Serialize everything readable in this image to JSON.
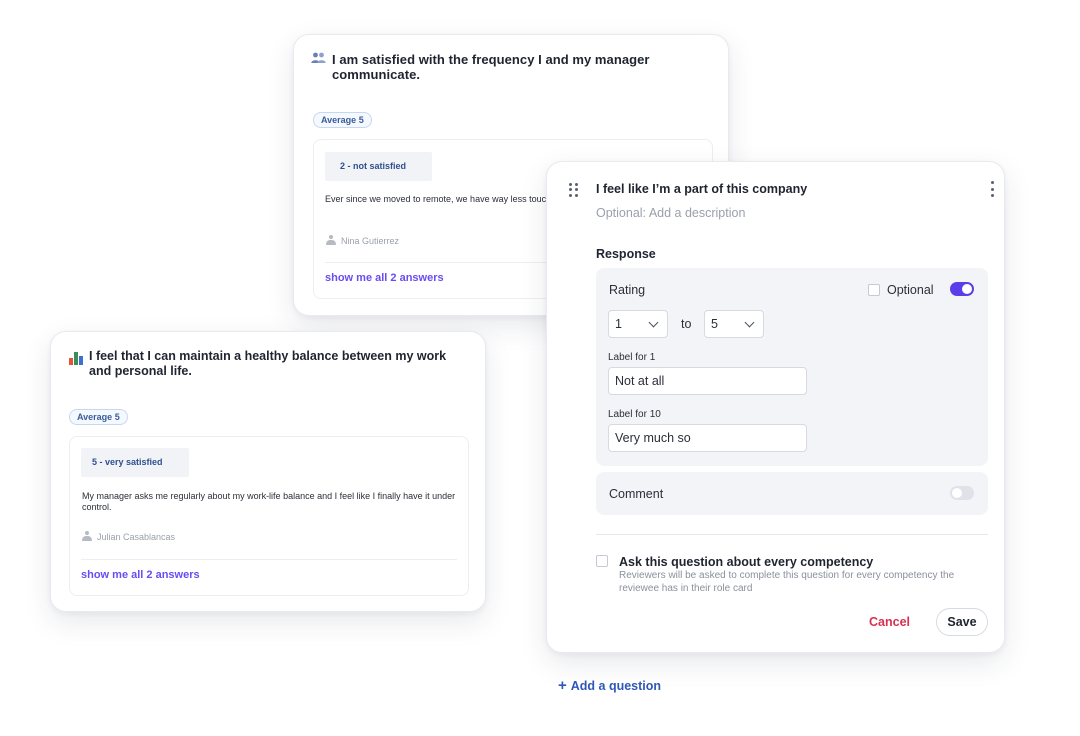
{
  "colors": {
    "accent_purple": "#5b3ee9",
    "link_purple": "#6a4cf0",
    "link_blue": "#2e58b8",
    "cancel_red": "#d6324f",
    "badge_blue": "#3b5c9a"
  },
  "card_frequency": {
    "icon": "people-icon",
    "question": "I am satisfied with the frequency I and my manager communicate.",
    "average_badge": "Average 5",
    "answer": {
      "score": "2 - not satisfied",
      "text": "Ever since we moved to remote, we have way less touch",
      "author": "Nina Gutierrez"
    },
    "show_all": "show me all 2 answers"
  },
  "card_balance": {
    "icon": "bar-chart-icon",
    "question": "I feel that I can maintain a healthy balance between my work and personal life.",
    "average_badge": "Average 5",
    "answer": {
      "score": "5 - very satisfied",
      "text": "My manager asks me regularly about my work-life balance and I feel like I finally have it under control.",
      "author": "Julian Casablancas"
    },
    "show_all": "show me all 2 answers"
  },
  "editor": {
    "question_title": "I feel like I’m a part of this company",
    "description_placeholder": "Optional: Add a description",
    "response_heading": "Response",
    "rating": {
      "label": "Rating",
      "optional_label": "Optional",
      "optional_checked": false,
      "toggle_on": true,
      "from_value": "1",
      "to_label": "to",
      "to_value": "5",
      "label_for_1_caption": "Label for 1",
      "label_for_1_value": "Not at all",
      "label_for_10_caption": "Label for 10",
      "label_for_10_value": "Very much so"
    },
    "comment": {
      "label": "Comment",
      "toggle_on": false
    },
    "competency": {
      "checked": false,
      "title": "Ask this question about every competency",
      "description": "Reviewers will be asked to complete this question for every competency the reviewee has in their role card"
    },
    "cancel_label": "Cancel",
    "save_label": "Save"
  },
  "add_question": {
    "icon": "plus-icon",
    "label": "Add a question"
  }
}
